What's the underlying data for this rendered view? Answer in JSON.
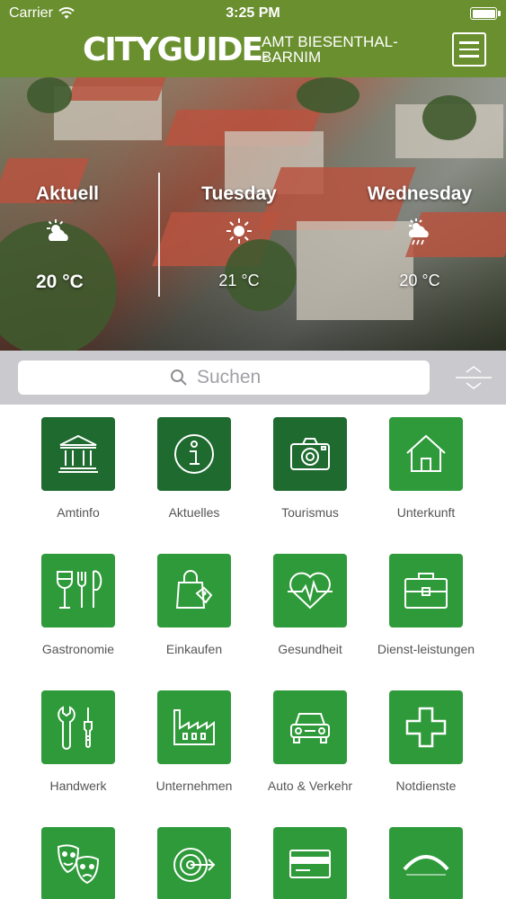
{
  "status_bar": {
    "carrier": "Carrier",
    "time": "3:25 PM",
    "battery_level": 1.0
  },
  "header": {
    "logo_text": "CITYGUIDE",
    "logo_mark": "®",
    "place_line1": "AMT BIESENTHAL-",
    "place_line2": "BARNIM",
    "menu_icon": "hamburger-menu-icon"
  },
  "weather": [
    {
      "day": "Aktuell",
      "icon": "partly-cloudy-icon",
      "temp": "20 °C"
    },
    {
      "day": "Tuesday",
      "icon": "sun-icon",
      "temp": "21 °C"
    },
    {
      "day": "Wednesday",
      "icon": "rain-cloud-icon",
      "temp": "20 °C"
    }
  ],
  "search": {
    "placeholder": "Suchen",
    "icon": "search-icon",
    "toggle_icon": "expand-collapse-icon"
  },
  "colors": {
    "brand_green": "#6a8f2f",
    "tile_dark_green": "#1e6a2f",
    "tile_green": "#2f9a3a",
    "search_bar_bg": "#c9c9ce"
  },
  "tiles": [
    {
      "label": "Amtinfo",
      "icon": "town-hall-icon",
      "shade": "dark"
    },
    {
      "label": "Aktuelles",
      "icon": "info-icon",
      "shade": "dark"
    },
    {
      "label": "Tourismus",
      "icon": "camera-icon",
      "shade": "dark"
    },
    {
      "label": "Unterkunft",
      "icon": "house-icon",
      "shade": "light"
    },
    {
      "label": "Gastronomie",
      "icon": "wine-cutlery-icon",
      "shade": "light"
    },
    {
      "label": "Einkaufen",
      "icon": "shopping-bag-icon",
      "shade": "light"
    },
    {
      "label": "Gesundheit",
      "icon": "heartbeat-icon",
      "shade": "light"
    },
    {
      "label": "Dienst-leistungen",
      "icon": "briefcase-icon",
      "shade": "light"
    },
    {
      "label": "Handwerk",
      "icon": "tools-icon",
      "shade": "light"
    },
    {
      "label": "Unternehmen",
      "icon": "factory-icon",
      "shade": "light"
    },
    {
      "label": "Auto & Verkehr",
      "icon": "car-icon",
      "shade": "light"
    },
    {
      "label": "Notdienste",
      "icon": "medical-cross-icon",
      "shade": "light"
    },
    {
      "label": "",
      "icon": "theater-masks-icon",
      "shade": "light"
    },
    {
      "label": "",
      "icon": "target-icon",
      "shade": "light"
    },
    {
      "label": "",
      "icon": "card-icon",
      "shade": "light"
    },
    {
      "label": "",
      "icon": "partner-logo-icon",
      "shade": "light"
    }
  ]
}
